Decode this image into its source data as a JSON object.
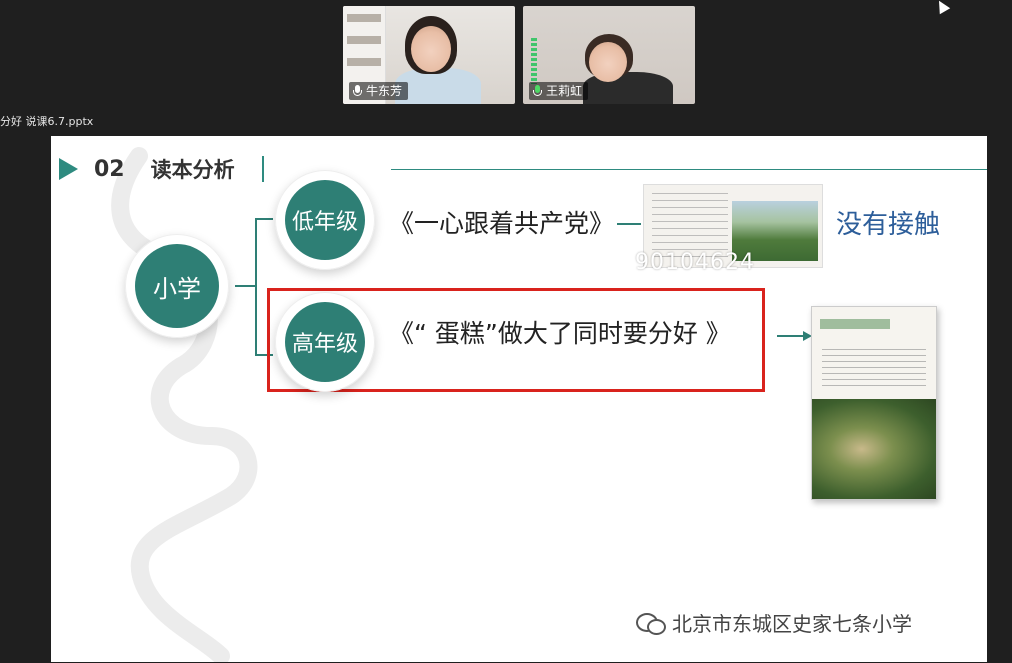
{
  "meeting": {
    "participants": [
      {
        "name": "牛东芳"
      },
      {
        "name": "王莉虹"
      }
    ],
    "file_name": "分好  说课6.7.pptx"
  },
  "slide": {
    "section_number": "02",
    "section_title": "读本分析",
    "root_node": "小学",
    "nodes": [
      {
        "label": "低年级",
        "book": "《一心跟着共产党》",
        "note": "没有接触"
      },
      {
        "label": "高年级",
        "book": "《“  蛋糕”做大了同时要分好   》"
      }
    ],
    "overlay_number": "90104624",
    "watermark": "北京市东城区史家七条小学",
    "accent_color": "#2e7f75",
    "highlight_color": "#d9231d"
  }
}
